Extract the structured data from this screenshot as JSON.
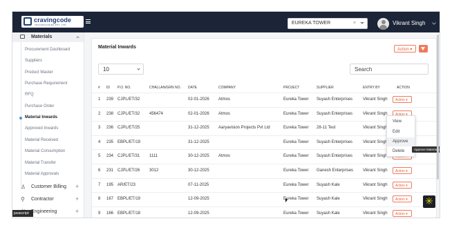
{
  "header": {
    "logo_name": "cravingcode",
    "logo_tagline": "TECHNOLOGIES PVT. LTD.",
    "project": "EUREKA TOWER",
    "clear_glyph": "×",
    "user_name": "Vikrant Singh"
  },
  "sidebar": {
    "section": "Materials",
    "items": [
      {
        "label": "Procurement Dashboard"
      },
      {
        "label": "Suppliers"
      },
      {
        "label": "Product Master"
      },
      {
        "label": "Purchase Requirement"
      },
      {
        "label": "RFQ"
      },
      {
        "label": "Purchase Order"
      },
      {
        "label": "Material Inwards"
      },
      {
        "label": "Approved Inwards"
      },
      {
        "label": "Material Received"
      },
      {
        "label": "Material Consumption"
      },
      {
        "label": "Material Transfer"
      },
      {
        "label": "Material Approvals"
      }
    ],
    "active_item": "Material Inwards",
    "groups": [
      {
        "label": "Customer Billing",
        "icon": "person-icon"
      },
      {
        "label": "Contractor",
        "icon": "contractor-icon"
      },
      {
        "label": "Engineering",
        "icon": "engineering-icon"
      }
    ],
    "js_tooltip": "javascript:"
  },
  "main": {
    "title": "Material Inwards",
    "action_label": "Action",
    "page_size": "10",
    "search_placeholder": "Search",
    "columns": [
      "#",
      "ID",
      "P.O. NO.",
      "CHALLAN/GRN NO.",
      "DATE",
      "COMPANY",
      "PROJECT",
      "SUPPLIER",
      "ENTRY BY",
      "ACTION"
    ],
    "rows": [
      {
        "n": "1",
        "id": "239",
        "po": "CJPL/ET/32",
        "challan": "",
        "date": "02-01-2026",
        "company": "Atmos",
        "project": "Eureka Tower",
        "supplier": "Suyash Enterprises",
        "entry": "Vikrant Singh",
        "action": "Action"
      },
      {
        "n": "2",
        "id": "238",
        "po": "CJPL/ET/32",
        "challan": "456474",
        "date": "02-01-2026",
        "company": "Atmos",
        "project": "Eureka Tower",
        "supplier": "Suyash Enterprises",
        "entry": "Vikrant Singh",
        "action": "Action"
      },
      {
        "n": "3",
        "id": "236",
        "po": "CJPL/ET/25",
        "challan": "",
        "date": "31-12-2025",
        "company": "Aaryavision Projects Pvt Ltd",
        "project": "Eureka Tower",
        "supplier": "28-11 Test",
        "entry": "Vikrant Singh",
        "action": "Action"
      },
      {
        "n": "4",
        "id": "235",
        "po": "EBPL/ET/19",
        "challan": "",
        "date": "31-12-2025",
        "company": "",
        "project": "Eureka Tower",
        "supplier": "Suyash Enterprises",
        "entry": "Vikrant Singh",
        "action": "Action"
      },
      {
        "n": "5",
        "id": "234",
        "po": "CJPL/ET/31",
        "challan": "1111",
        "date": "30-12-2025",
        "company": "Atmos",
        "project": "Eureka Tower",
        "supplier": "Suyash Enterprises",
        "entry": "Vikrant Singh",
        "action": "Action"
      },
      {
        "n": "6",
        "id": "231",
        "po": "CJPL/ET/26",
        "challan": "3012",
        "date": "30-12-2025",
        "company": "",
        "project": "Eureka Tower",
        "supplier": "Ganesh Enterprises",
        "entry": "Vikrant Singh",
        "action": "Action"
      },
      {
        "n": "7",
        "id": "195",
        "po": "AR/ET/23",
        "challan": "",
        "date": "07-11-2025",
        "company": "",
        "project": "Eureka Tower",
        "supplier": "Suyash Kale",
        "entry": "Vikrant Singh",
        "action": "Action"
      },
      {
        "n": "8",
        "id": "167",
        "po": "EBPL/ET/19",
        "challan": "",
        "date": "12-09-2025",
        "company": "",
        "project": "Eureka Tower",
        "supplier": "Suyash Kale",
        "entry": "Vikrant Singh",
        "action": "Action"
      },
      {
        "n": "9",
        "id": "166",
        "po": "EBPL/ET/18",
        "challan": "",
        "date": "12-09-2025",
        "company": "",
        "project": "Eureka Tower",
        "supplier": "Suyash Kale",
        "entry": "Vikrant Singh",
        "action": "Action"
      }
    ],
    "dropdown": {
      "items": [
        "View",
        "Edit",
        "Approve",
        "Delete"
      ],
      "highlighted": "Approve"
    },
    "tooltip": "Approve Material Inward"
  },
  "colors": {
    "topbar": "#1c2437",
    "accent": "#f07a5a",
    "active_dot": "#4a90e2"
  }
}
